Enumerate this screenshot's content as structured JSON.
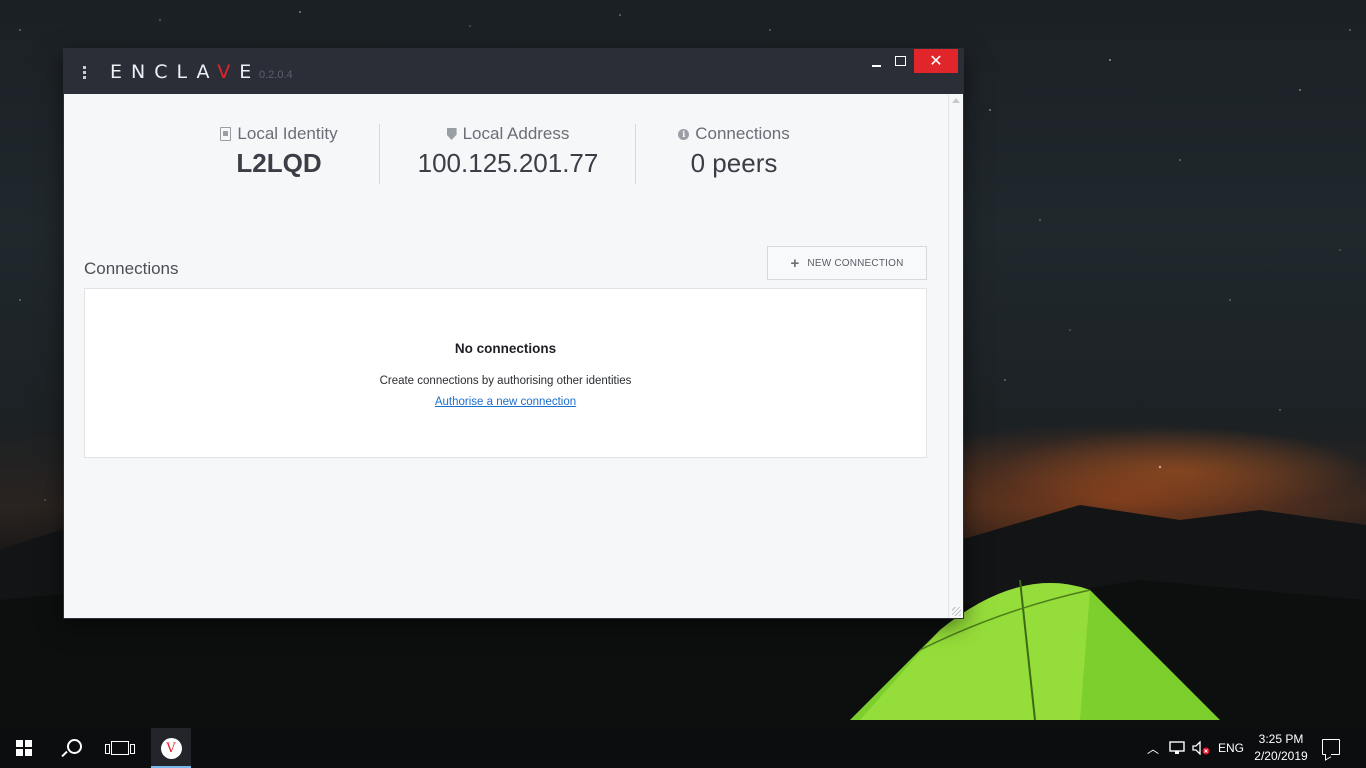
{
  "app": {
    "name_before": "ENCLA",
    "name_accent": "V",
    "name_after": "E",
    "version": "0.2.0.4",
    "accent_color": "#e0242b"
  },
  "stats": {
    "identity": {
      "label": "Local Identity",
      "value": "L2LQD",
      "icon": "id-badge-icon"
    },
    "address": {
      "label": "Local Address",
      "value": "100.125.201.77",
      "icon": "shield-icon"
    },
    "connections": {
      "label": "Connections",
      "value": "0 peers",
      "icon": "info-icon"
    }
  },
  "connections_section": {
    "title": "Connections",
    "new_button": "NEW CONNECTION",
    "empty_title": "No connections",
    "empty_description": "Create connections by authorising other identities",
    "empty_link": "Authorise a new connection"
  },
  "taskbar": {
    "language": "ENG",
    "time": "3:25 PM",
    "date": "2/20/2019"
  }
}
